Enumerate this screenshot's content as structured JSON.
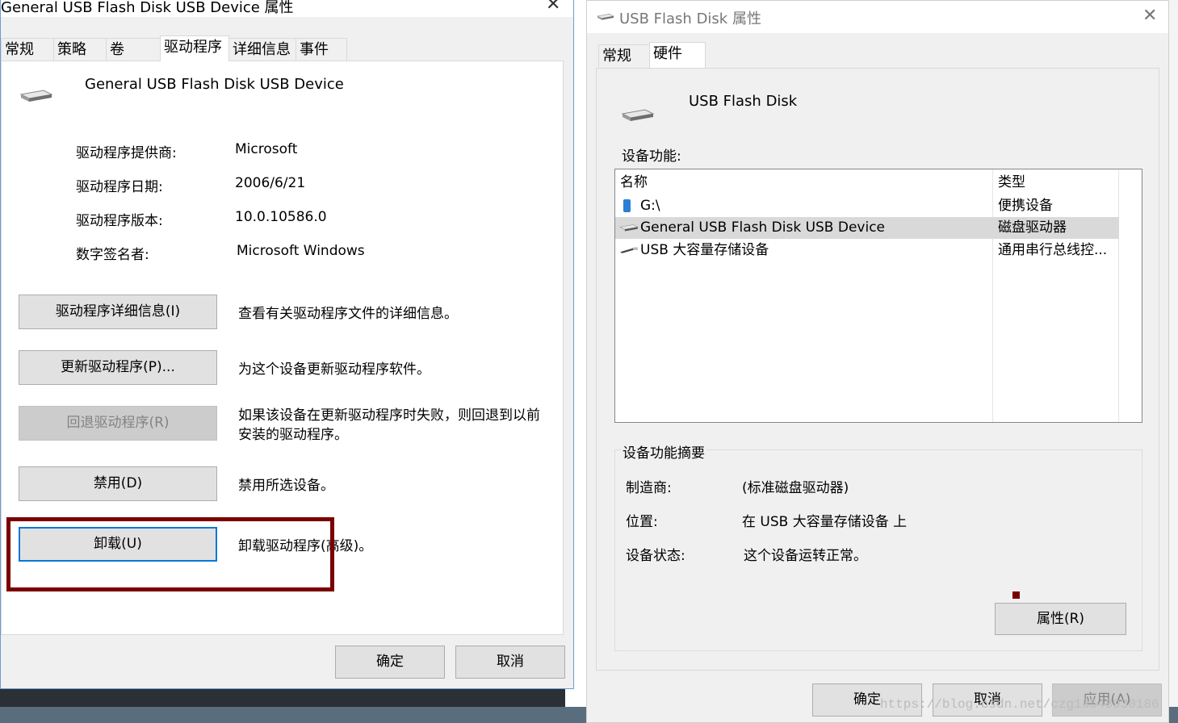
{
  "left_dialog": {
    "title": "General USB Flash Disk USB Device 属性",
    "tabs": [
      "常规",
      "策略",
      "卷",
      "驱动程序",
      "详细信息",
      "事件"
    ],
    "device_name": "General USB Flash Disk USB Device",
    "info": [
      {
        "label": "驱动程序提供商:",
        "value": "Microsoft"
      },
      {
        "label": "驱动程序日期:",
        "value": "2006/6/21"
      },
      {
        "label": "驱动程序版本:",
        "value": "10.0.10586.0"
      },
      {
        "label": "数字签名者:",
        "value": "Microsoft Windows"
      }
    ],
    "actions": [
      {
        "button": "驱动程序详细信息(I)",
        "desc": "查看有关驱动程序文件的详细信息。"
      },
      {
        "button": "更新驱动程序(P)...",
        "desc": "为这个设备更新驱动程序软件。"
      },
      {
        "button": "回退驱动程序(R)",
        "desc": "如果该设备在更新驱动程序时失败，则回退到以前安装的驱动程序。"
      },
      {
        "button": "禁用(D)",
        "desc": "禁用所选设备。"
      },
      {
        "button": "卸载(U)",
        "desc": "卸载驱动程序(高级)。"
      }
    ],
    "ok": "确定",
    "cancel": "取消"
  },
  "right_dialog": {
    "title": "USB Flash Disk 属性",
    "tabs": [
      "常规",
      "硬件"
    ],
    "device_name": "USB Flash Disk",
    "functions_label": "设备功能:",
    "columns": [
      "名称",
      "类型"
    ],
    "rows": [
      {
        "name": "G:\\",
        "type": "便携设备",
        "icon": "portable-device-icon"
      },
      {
        "name": "General USB Flash Disk USB Device",
        "type": "磁盘驱动器",
        "icon": "disk-drive-icon"
      },
      {
        "name": "USB 大容量存储设备",
        "type": "通用串行总线控...",
        "icon": "usb-icon"
      }
    ],
    "summary_label": "设备功能摘要",
    "summary": [
      {
        "label": "制造商:",
        "value": "(标准磁盘驱动器)"
      },
      {
        "label": "位置:",
        "value": "在 USB 大容量存储设备 上"
      },
      {
        "label": "设备状态:",
        "value": "这个设备运转正常。"
      }
    ],
    "properties": "属性(R)",
    "ok": "确定",
    "cancel": "取消",
    "apply": "应用(A)"
  },
  "watermark": "https://blog.csdn.net/czg13548930186"
}
